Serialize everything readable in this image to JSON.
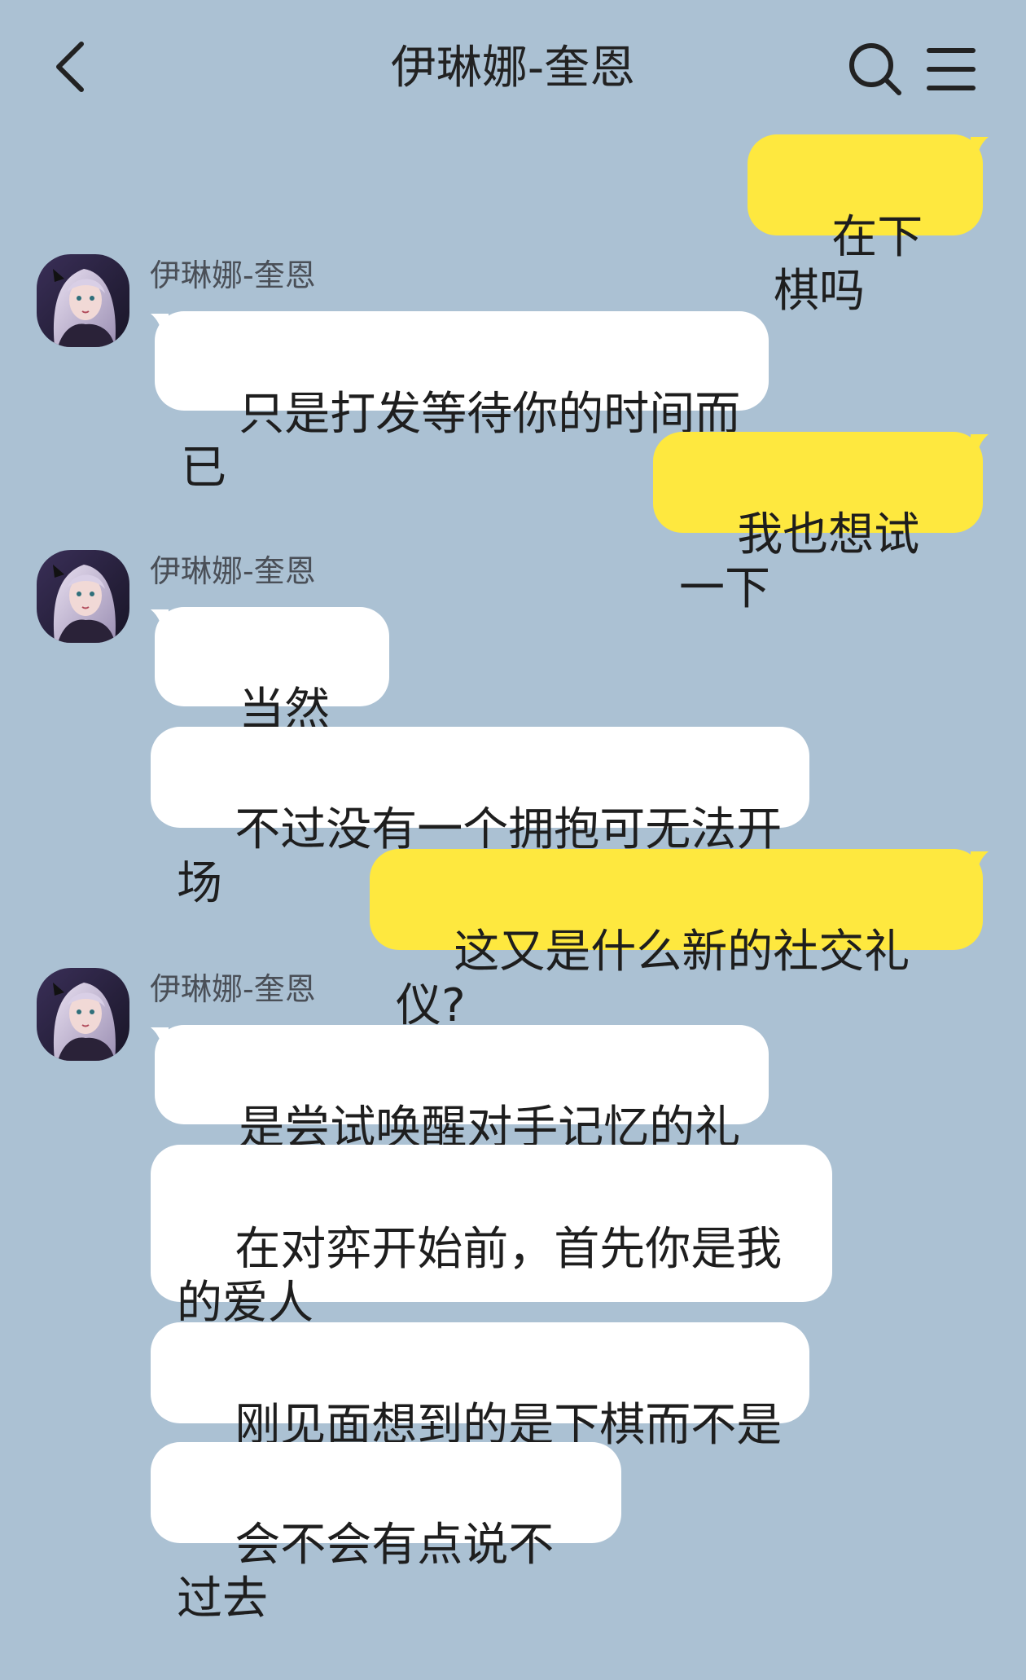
{
  "header": {
    "title": "伊琳娜-奎恩",
    "back_icon": "chevron-left-icon",
    "search_icon": "search-icon",
    "menu_icon": "menu-icon"
  },
  "colors": {
    "background": "#abc1d3",
    "outgoing_bubble": "#fee83f",
    "incoming_bubble": "#ffffff"
  },
  "messages": [
    {
      "from": "me",
      "text": "在下棋吗"
    },
    {
      "from": "them",
      "sender": "伊琳娜-奎恩",
      "text": "只是打发等待你的时间而已"
    },
    {
      "from": "me",
      "text": "我也想试一下"
    },
    {
      "from": "them",
      "sender": "伊琳娜-奎恩",
      "text": "当然可以"
    },
    {
      "from": "them",
      "text": "不过没有一个拥抱可无法开场"
    },
    {
      "from": "me",
      "text": "这又是什么新的社交礼仪?"
    },
    {
      "from": "them",
      "sender": "伊琳娜-奎恩",
      "text": "是尝试唤醒对手记忆的礼仪"
    },
    {
      "from": "them",
      "text": "在对弈开始前，首先你是我的爱人"
    },
    {
      "from": "them",
      "text": "刚见面想到的是下棋而不是我"
    },
    {
      "from": "them",
      "text": "会不会有点说不过去"
    }
  ]
}
